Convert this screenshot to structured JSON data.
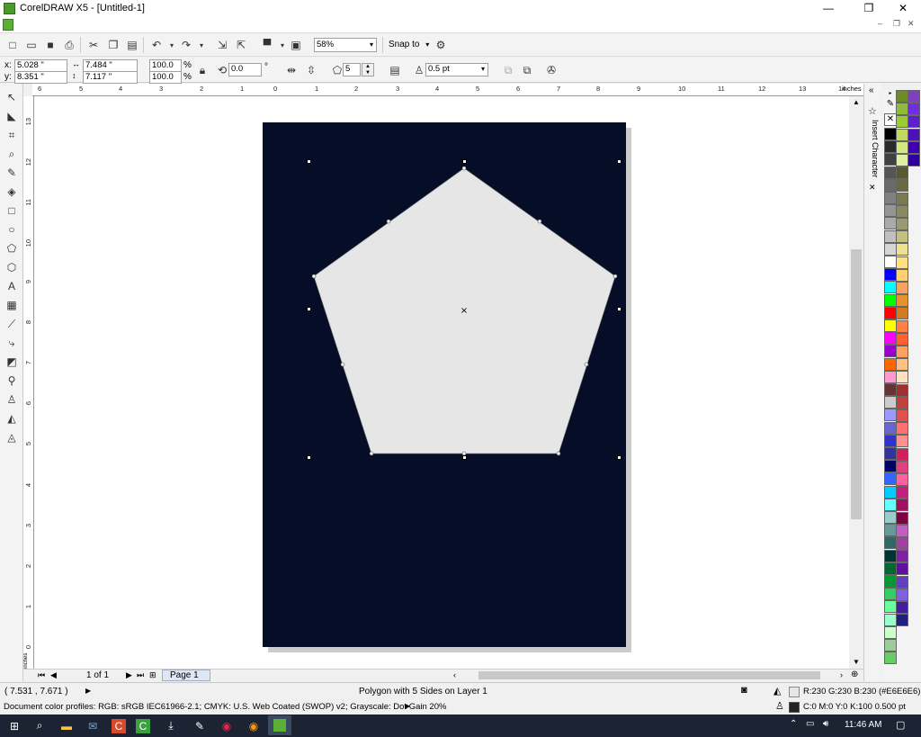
{
  "window": {
    "title": "CorelDRAW X5 - [Untitled-1]",
    "min": "—",
    "max": "❐",
    "close": "✕"
  },
  "toolbar": {
    "zoom": "58%",
    "snap_to": "Snap to"
  },
  "property_bar": {
    "x_label": "x:",
    "x": "5.028 \"",
    "y_label": "y:",
    "y": "8.351 \"",
    "width": "7.484 \"",
    "height": "7.117 \"",
    "scale_x": "100.0",
    "scale_y": "100.0",
    "percent": "%",
    "rotation": "0.0",
    "degree": "°",
    "sides": "5",
    "outline": "0.5 pt"
  },
  "rulers": {
    "units": "inches",
    "top_numbers": [
      "6",
      "5",
      "4",
      "3",
      "2",
      "1",
      "0",
      "1",
      "2",
      "3",
      "4",
      "5",
      "6",
      "7",
      "8",
      "9",
      "10",
      "11",
      "12",
      "13",
      "14"
    ],
    "left_numbers": [
      "13",
      "12",
      "11",
      "10",
      "9",
      "8",
      "7",
      "6",
      "5",
      "4",
      "3",
      "2",
      "1",
      "0"
    ]
  },
  "docker": {
    "label": "Insert Character"
  },
  "page_nav": {
    "page_count": "1 of 1",
    "page_tab": "Page 1"
  },
  "status": {
    "cursor": "( 7.531 , 7.671 )",
    "arrow": "▶",
    "object_info": "Polygon with 5 Sides on Layer 1",
    "fill_info": "R:230 G:230 B:230 (#E6E6E6)",
    "outline_info": "C:0 M:0 Y:0 K:100  0.500 pt",
    "color_profiles": "Document color profiles: RGB: sRGB IEC61966-2.1; CMYK: U.S. Web Coated (SWOP) v2; Grayscale: Dot Gain 20%"
  },
  "taskbar": {
    "time": "11:46 AM"
  },
  "colors": {
    "page_bg": "#050d27",
    "polygon_fill": "#E6E6E6",
    "accent": "#4a9a2a"
  },
  "palette_left": [
    "#000000",
    "#2b2b2b",
    "#404040",
    "#555555",
    "#6a6a6a",
    "#808080",
    "#959595",
    "#aaaaaa",
    "#c0c0c0",
    "#d5d5d5",
    "#ffffff",
    "#0000ff",
    "#00ffff",
    "#00ff00",
    "#ff0000",
    "#ffff00",
    "#ff00ff",
    "#9900cc",
    "#ff6600",
    "#ff99cc",
    "#663333",
    "#cccccc",
    "#9999ff",
    "#6666cc",
    "#3333cc",
    "#333399",
    "#000066",
    "#3366ff",
    "#00ccff",
    "#66ffff",
    "#99cccc",
    "#669999",
    "#336666",
    "#003333",
    "#006633",
    "#009933",
    "#33cc66",
    "#66ff99",
    "#99ffcc",
    "#ccffcc",
    "#99cc99",
    "#66cc66"
  ],
  "palette_right": [
    "#6b8e23",
    "#8fbc3a",
    "#9acd32",
    "#c0d860",
    "#d4e880",
    "#e0f0a0",
    "#5a5a30",
    "#6a6a40",
    "#7a7a50",
    "#8a8a60",
    "#9a9a70",
    "#c6c080",
    "#f0e090",
    "#ffe080",
    "#ffd070",
    "#f4a460",
    "#e8902a",
    "#d27a1c",
    "#ff8040",
    "#ff6030",
    "#ffa060",
    "#ffc080",
    "#ffe0c0",
    "#a03030",
    "#c04040",
    "#e05050",
    "#ff7070",
    "#ff9090",
    "#d02060",
    "#e04080",
    "#ff60a0",
    "#c02080",
    "#a01060",
    "#800040",
    "#c060c0",
    "#a040a0",
    "#8020a0",
    "#6010a0",
    "#6040c0",
    "#8060e0",
    "#40209a",
    "#202080"
  ],
  "palette_third": [
    "#7f3fbf",
    "#6f2fdf",
    "#5f1fcf",
    "#4f0fbf",
    "#3f00af",
    "#2f009f"
  ]
}
